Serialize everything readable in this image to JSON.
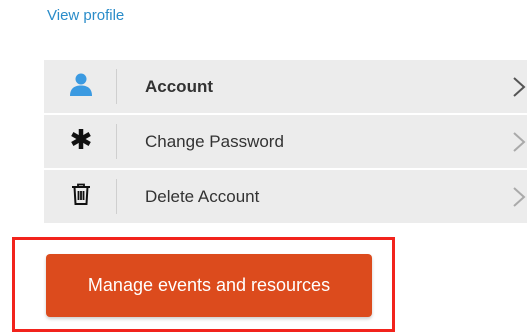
{
  "profile": {
    "view_profile_label": "View profile"
  },
  "menu": {
    "items": [
      {
        "label": "Account",
        "icon": "user-icon",
        "bold": true
      },
      {
        "label": "Change Password",
        "icon": "asterisk-icon",
        "bold": false
      },
      {
        "label": "Delete Account",
        "icon": "trash-icon",
        "bold": false
      }
    ]
  },
  "actions": {
    "manage_label": "Manage events and resources"
  },
  "colors": {
    "link": "#2a8cc9",
    "user_icon": "#3b9ae1",
    "primary_button": "#dc4b1d",
    "highlight_border": "#f2231c",
    "menu_bg": "#ececec"
  }
}
